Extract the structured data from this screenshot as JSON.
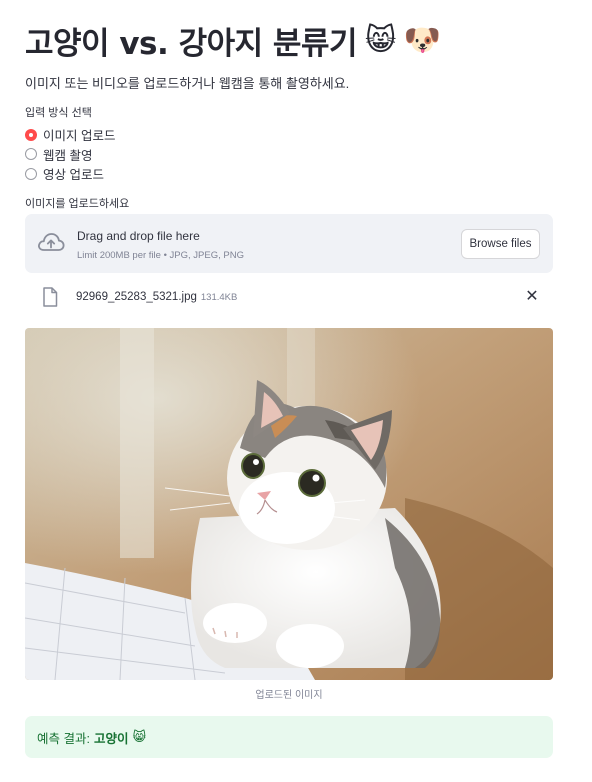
{
  "header": {
    "title": "고양이 vs. 강아지 분류기",
    "cat_emoji": "😸",
    "dog_emoji": "🐶",
    "subtitle": "이미지 또는 비디오를 업로드하거나 웹캠을 통해 촬영하세요."
  },
  "input_mode": {
    "label": "입력 방식 선택",
    "options": [
      "이미지 업로드",
      "웹캠 촬영",
      "영상 업로드"
    ],
    "selected": "이미지 업로드"
  },
  "uploader": {
    "label": "이미지를 업로드하세요",
    "drag_text": "Drag and drop file here",
    "limit_text": "Limit 200MB per file • JPG, JPEG, PNG",
    "browse_label": "Browse files",
    "file": {
      "name": "92969_25283_5321.jpg",
      "size": "131.4KB"
    },
    "close_glyph": "✕"
  },
  "image": {
    "caption": "업로드된 이미지"
  },
  "result": {
    "prefix": "예측 결과:",
    "value": "고양이",
    "emoji": "😸"
  },
  "colors": {
    "accent": "#ff4b4b",
    "success_bg": "#e8f9ee",
    "success_text": "#177233",
    "dropzone_bg": "#f0f2f6"
  }
}
